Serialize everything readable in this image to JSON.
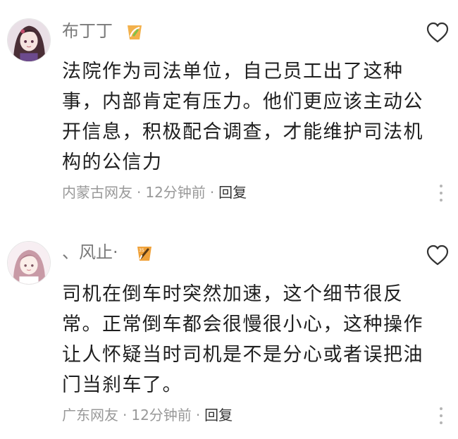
{
  "comments": [
    {
      "username": "布丁丁",
      "badge_icon": "vip-leaf-badge-icon",
      "text_lines": [
        "法院作为司法单位，自己员工出了这种",
        "事，内部肯定有压力。他们更应该主动公",
        "开信息，积极配合调查，才能维护司法机",
        "构的公信力"
      ],
      "location": "内蒙古网友",
      "time": "12分钟前",
      "reply_label": "回复",
      "separator": "·"
    },
    {
      "username": "、风止·",
      "badge_icon": "vip-pencil-badge-icon",
      "text_lines": [
        "司机在倒车时突然加速，这个细节很反",
        "常。正常倒车都会很慢很小心，这种操作",
        "让人怀疑当时司机是不是分心或者误把油",
        "门当刹车了。"
      ],
      "location": "广东网友",
      "time": "12分钟前",
      "reply_label": "回复",
      "separator": "·"
    }
  ],
  "colors": {
    "username": "#7a7a7a",
    "meta": "#999999",
    "reply": "#333333",
    "badge_orange": "#f0a23a"
  }
}
